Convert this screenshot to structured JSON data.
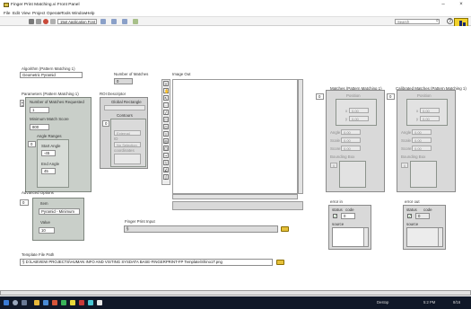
{
  "window": {
    "title": "Finger Print Matching.vi Front Panel",
    "minimize": "–",
    "close": "×"
  },
  "menu": [
    "File",
    "Edit",
    "View",
    "Project",
    "Operate",
    "Tools",
    "Window",
    "Help"
  ],
  "toolbar": {
    "font": "15pt Application Font",
    "search_placeholder": "Search"
  },
  "algorithm": {
    "label": "Algorithm (Pattern Matching 1)",
    "value": "Geometric Pyramid"
  },
  "number_of_matches": {
    "label": "Number of Matches",
    "value": "0"
  },
  "parameters": {
    "label": "Parameters (Pattern Matching 1)",
    "index": "0",
    "matches_requested_label": "Number of Matches Requested",
    "matches_requested_value": "1",
    "min_score_label": "Minimum Match Score",
    "min_score_value": "800",
    "angle_ranges_label": "Angle Ranges",
    "angle_index": "0",
    "start_angle_label": "Start Angle",
    "start_angle_value": "-45",
    "end_angle_label": "End Angle",
    "end_angle_value": "45"
  },
  "roi": {
    "label": "ROI Descriptor",
    "global_rect_label": "Global Rectangle",
    "index": "0",
    "contours_label": "Contours",
    "external": "External",
    "id_label": "ID",
    "no_selection": "No Selection",
    "coordinates": "coordinates"
  },
  "image_out": {
    "label": "Image Out"
  },
  "matches": {
    "label": "Matches (Pattern Matching 1)",
    "index": "0",
    "position_label": "Position",
    "x_label": "x",
    "x_value": "0.00",
    "y_label": "y",
    "y_value": "0.00",
    "angle_label": "Angle",
    "angle_value": "0.00",
    "scale_label": "Scale",
    "scale_value": "0.00",
    "score_label": "Score",
    "score_value": "0.00",
    "bbox_label": "Bounding Box",
    "bbox_index": "0"
  },
  "calibrated_matches": {
    "label": "Calibrated Matches (Pattern Matching 1)",
    "index": "0",
    "position_label": "Position",
    "x_label": "x",
    "x_value": "0.00",
    "y_label": "y",
    "y_value": "0.00",
    "angle_label": "Angle",
    "angle_value": "0.00",
    "scale_label": "Scale",
    "scale_value": "0.00",
    "score_label": "Score",
    "score_value": "0.00",
    "bbox_label": "Bounding Box",
    "bbox_index": "0"
  },
  "advanced_options": {
    "label": "Advanced Options",
    "index": "0",
    "item_label": "Item",
    "item_value": "Pyramid - Minimum",
    "value_label": "Value",
    "value_value": "10"
  },
  "finger_print_input": {
    "label": "Finger Print Input",
    "prefix": "§",
    "value": ""
  },
  "error_in": {
    "label": "error in",
    "status_label": "status",
    "code_label": "code",
    "code_value": "0",
    "source_label": "source",
    "check": "✓"
  },
  "error_out": {
    "label": "error out",
    "status_label": "status",
    "code_label": "code",
    "code_value": "0",
    "source_label": "source",
    "check": "✓"
  },
  "template_path": {
    "label": "Template File Path",
    "prefix": "§",
    "value": "D:\\LABVIEW PROJECTS\\HUMAN INFO AND VISTING SYSDATA BASE-FINGERPRINT-FP Template\\Shino1T.png"
  },
  "taskbar": {
    "tray_text": "Destop",
    "time": "5:2 PM",
    "date": "8/16"
  },
  "colors": {
    "cluster_bg": "#c9cfc9",
    "accent_yellow": "#e6c13a",
    "taskbar": "#101828"
  }
}
